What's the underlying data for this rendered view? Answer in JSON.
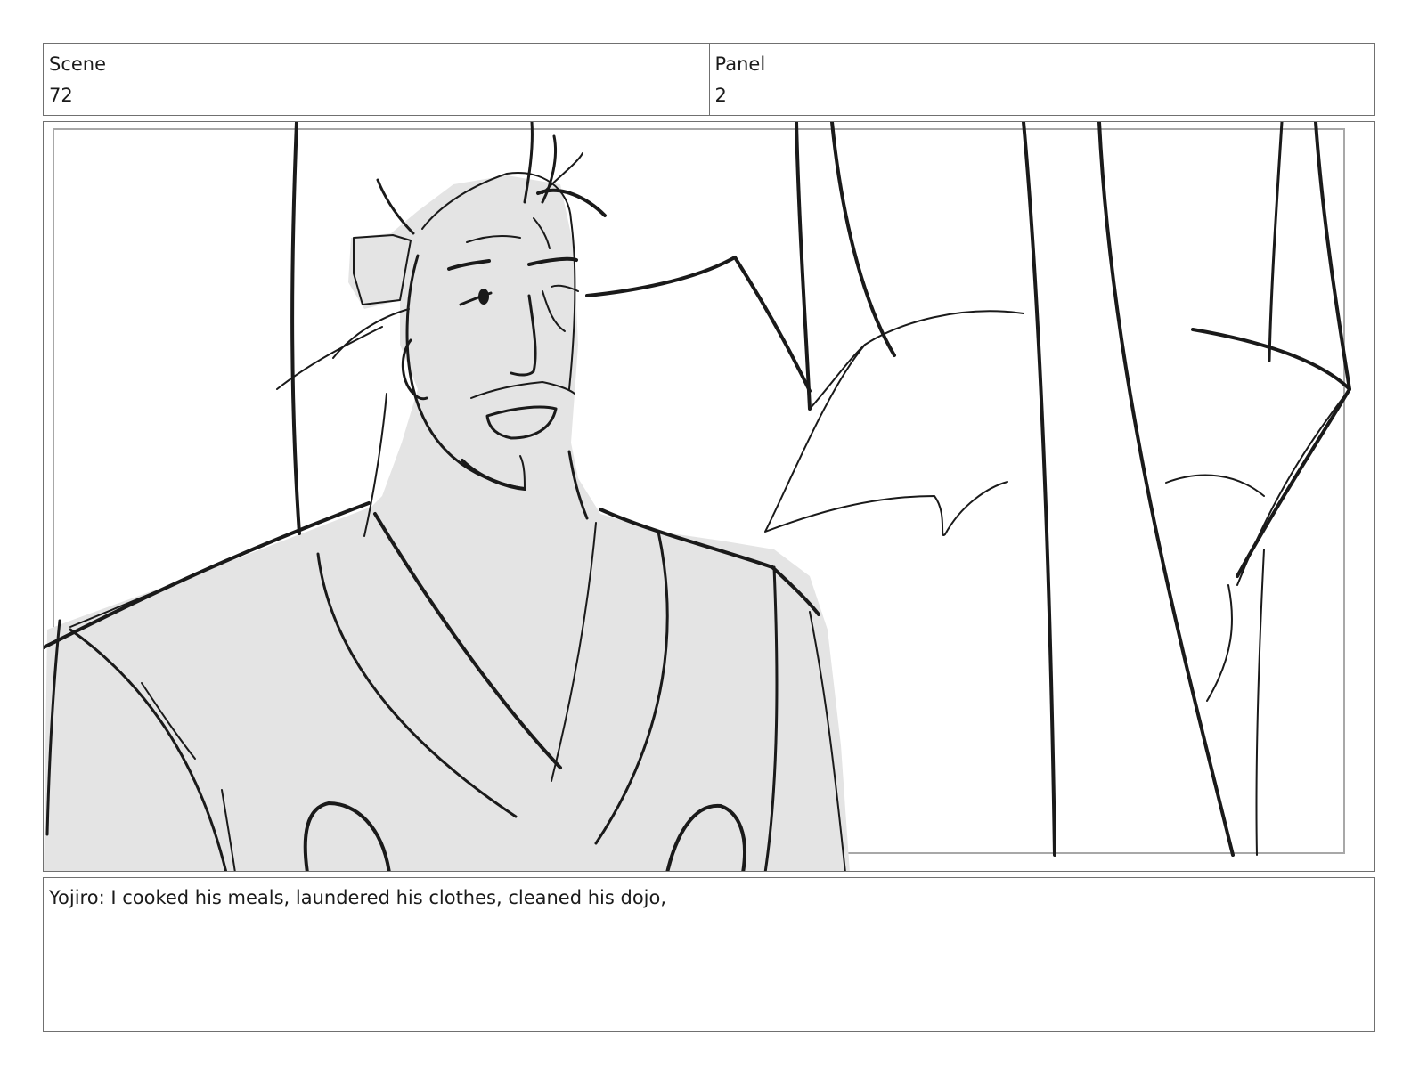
{
  "header": {
    "scene_label": "Scene",
    "scene_value": "72",
    "panel_label": "Panel",
    "panel_value": "2"
  },
  "notes": {
    "dialogue": "Yojiro: I cooked his meals, laundered his clothes, cleaned his dojo,"
  },
  "artwork": {
    "type": "storyboard-sketch",
    "palette": {
      "ink": "#1a1a1a",
      "tone": "#e4e4e4",
      "frame": "#a8a8a8"
    }
  }
}
